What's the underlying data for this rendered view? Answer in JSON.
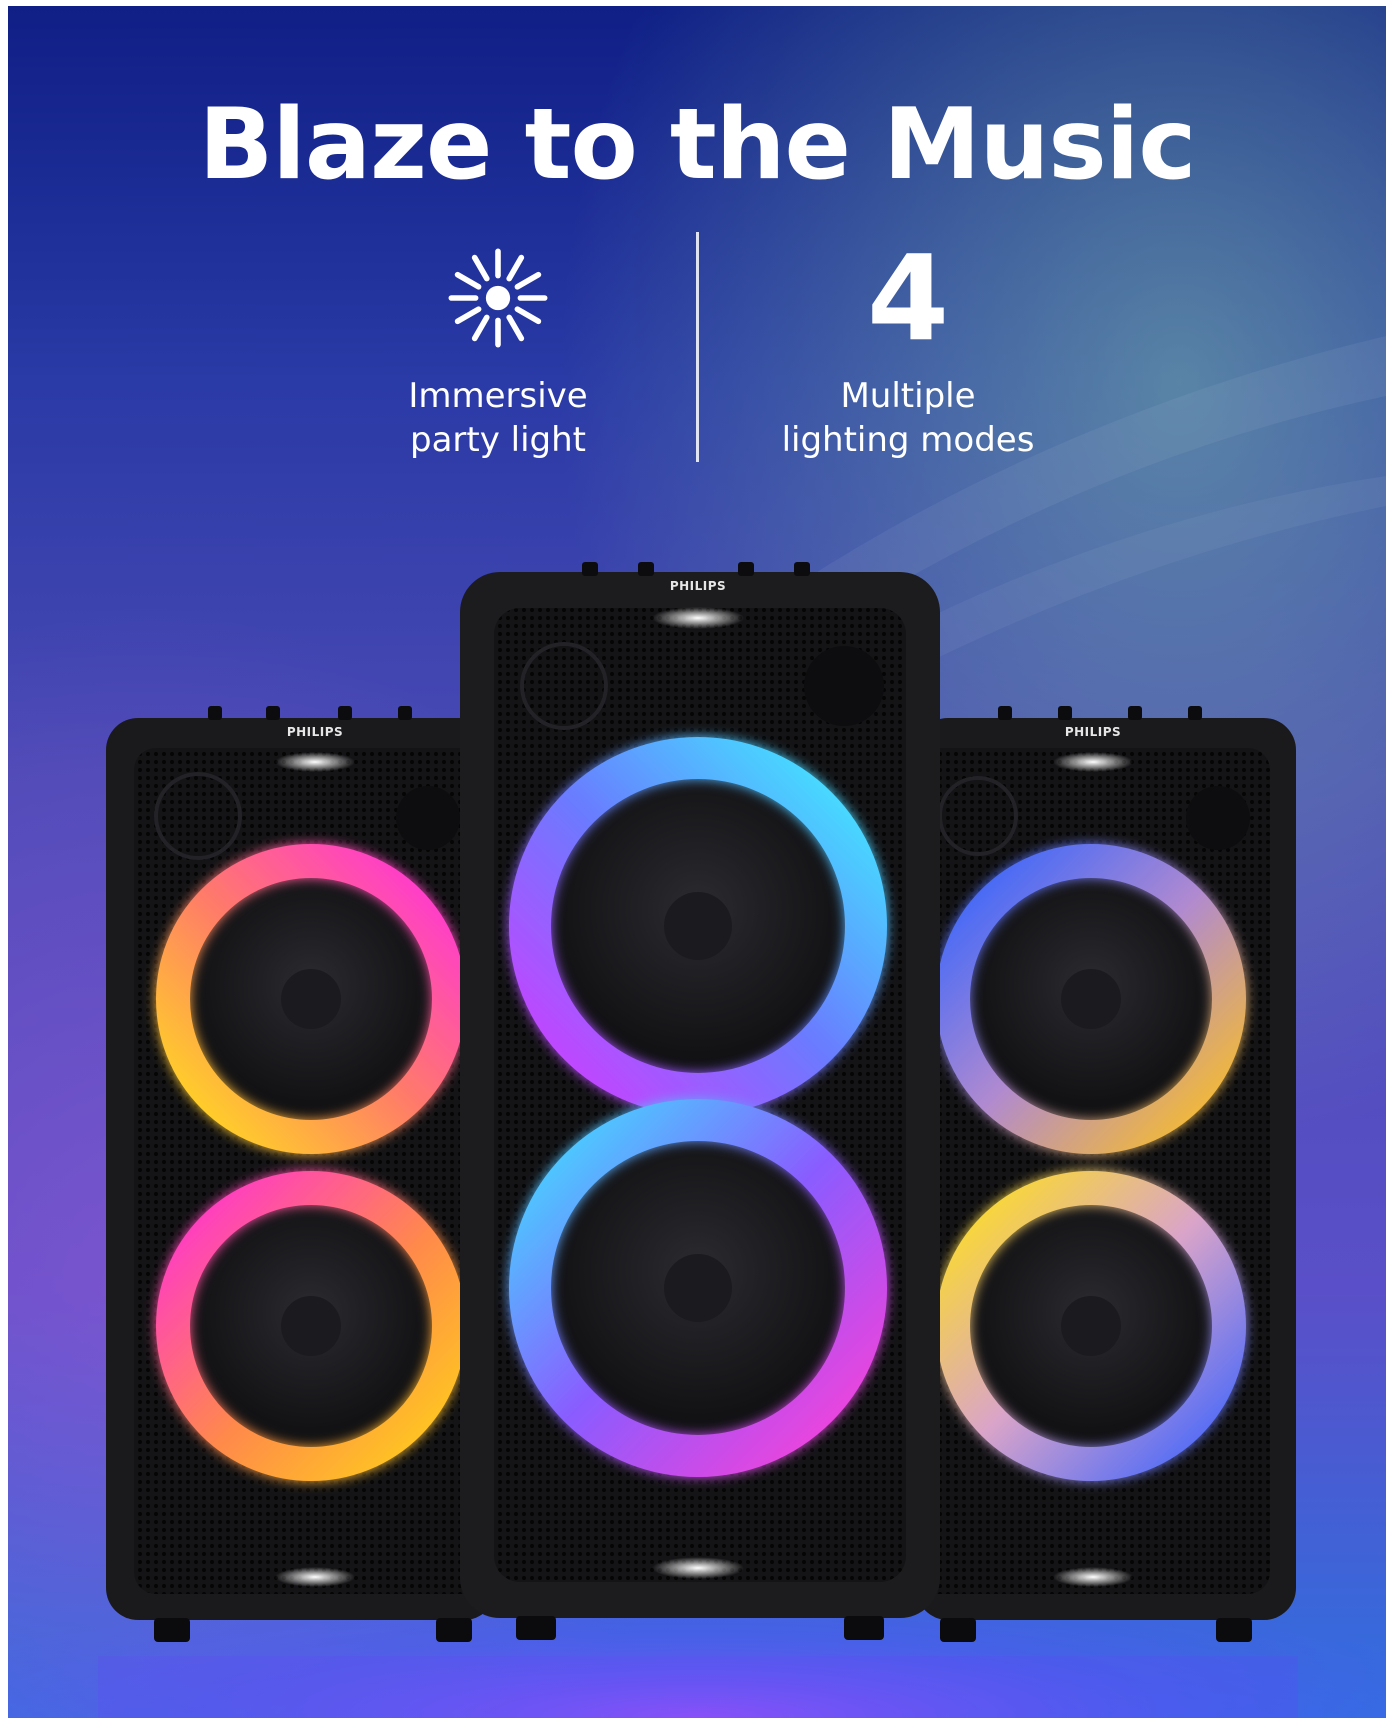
{
  "headline": "Blaze to the Music",
  "features": [
    {
      "icon": "sun-icon",
      "line1": "Immersive",
      "line2": "party light"
    },
    {
      "value": "4",
      "line1": "Multiple",
      "line2": "lighting modes"
    }
  ],
  "speakers": {
    "brand": "PHILIPS"
  },
  "colors": {
    "background_top": "#10217f",
    "background_mid": "#3b3aa8",
    "background_bottom": "#2a7fd8",
    "ring_left_top": [
      "#ff2fd8",
      "#ffe51a"
    ],
    "ring_center_top": [
      "#3fe7ff",
      "#d437ff"
    ],
    "ring_right_top": [
      "#3a6cff",
      "#ffc31a"
    ]
  }
}
